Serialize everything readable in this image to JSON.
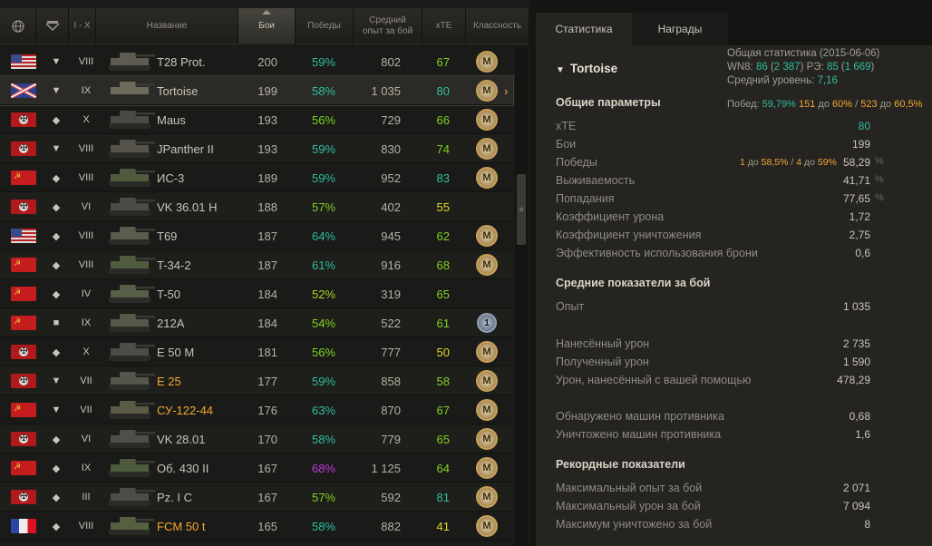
{
  "header": {
    "col_nation": "",
    "col_class": "",
    "col_tier": "I - X",
    "col_name": "Название",
    "col_battles": "Бои",
    "col_wins": "Победы",
    "col_exp": "Средний\nопыт за бой",
    "col_xte": "xTE",
    "col_mastery": "Классность"
  },
  "rows": [
    {
      "nation": "usa",
      "cls": "▼",
      "tier": "VIII",
      "name": "T28 Prot.",
      "prem": false,
      "battles": "200",
      "wins": "59%",
      "wcol": "c-teal",
      "exp": "802",
      "xte": "67",
      "xcol": "c-green",
      "badge": "M"
    },
    {
      "nation": "uk",
      "cls": "▼",
      "tier": "IX",
      "name": "Tortoise",
      "prem": false,
      "battles": "199",
      "wins": "58%",
      "wcol": "c-teal",
      "exp": "1 035",
      "xte": "80",
      "xcol": "c-teal",
      "badge": "M",
      "selected": true
    },
    {
      "nation": "ger",
      "cls": "◆",
      "tier": "X",
      "name": "Maus",
      "prem": false,
      "battles": "193",
      "wins": "56%",
      "wcol": "c-green",
      "exp": "729",
      "xte": "66",
      "xcol": "c-green",
      "badge": "M"
    },
    {
      "nation": "ger",
      "cls": "▼",
      "tier": "VIII",
      "name": "JPanther II",
      "prem": false,
      "battles": "193",
      "wins": "59%",
      "wcol": "c-teal",
      "exp": "830",
      "xte": "74",
      "xcol": "c-green",
      "badge": "M"
    },
    {
      "nation": "ussr",
      "cls": "◆",
      "tier": "VIII",
      "name": "ИС-3",
      "prem": false,
      "battles": "189",
      "wins": "59%",
      "wcol": "c-teal",
      "exp": "952",
      "xte": "83",
      "xcol": "c-teal",
      "badge": "M"
    },
    {
      "nation": "ger",
      "cls": "◆",
      "tier": "VI",
      "name": "VK 36.01 H",
      "prem": false,
      "battles": "188",
      "wins": "57%",
      "wcol": "c-green",
      "exp": "402",
      "xte": "55",
      "xcol": "c-yellow",
      "badge": ""
    },
    {
      "nation": "usa",
      "cls": "◆",
      "tier": "VIII",
      "name": "T69",
      "prem": false,
      "battles": "187",
      "wins": "64%",
      "wcol": "c-teal",
      "exp": "945",
      "xte": "62",
      "xcol": "c-green",
      "badge": "M"
    },
    {
      "nation": "ussr",
      "cls": "◆",
      "tier": "VIII",
      "name": "T-34-2",
      "prem": false,
      "battles": "187",
      "wins": "61%",
      "wcol": "c-teal",
      "exp": "916",
      "xte": "68",
      "xcol": "c-green",
      "badge": "M"
    },
    {
      "nation": "ussr",
      "cls": "◆",
      "tier": "IV",
      "name": "T-50",
      "prem": false,
      "battles": "184",
      "wins": "52%",
      "wcol": "c-lime",
      "exp": "319",
      "xte": "65",
      "xcol": "c-green",
      "badge": ""
    },
    {
      "nation": "ussr",
      "cls": "■",
      "tier": "IX",
      "name": "212A",
      "prem": false,
      "battles": "184",
      "wins": "54%",
      "wcol": "c-green",
      "exp": "522",
      "xte": "61",
      "xcol": "c-green",
      "badge": "1"
    },
    {
      "nation": "ger",
      "cls": "◆",
      "tier": "X",
      "name": "E 50 M",
      "prem": false,
      "battles": "181",
      "wins": "56%",
      "wcol": "c-green",
      "exp": "777",
      "xte": "50",
      "xcol": "c-yellow",
      "badge": "M"
    },
    {
      "nation": "ger",
      "cls": "▼",
      "tier": "VII",
      "name": "E 25",
      "prem": true,
      "battles": "177",
      "wins": "59%",
      "wcol": "c-teal",
      "exp": "858",
      "xte": "58",
      "xcol": "c-green",
      "badge": "M"
    },
    {
      "nation": "ussr",
      "cls": "▼",
      "tier": "VII",
      "name": "СУ-122-44",
      "prem": true,
      "battles": "176",
      "wins": "63%",
      "wcol": "c-teal",
      "exp": "870",
      "xte": "67",
      "xcol": "c-green",
      "badge": "M"
    },
    {
      "nation": "ger",
      "cls": "◆",
      "tier": "VI",
      "name": "VK 28.01",
      "prem": false,
      "battles": "170",
      "wins": "58%",
      "wcol": "c-teal",
      "exp": "779",
      "xte": "65",
      "xcol": "c-green",
      "badge": "M"
    },
    {
      "nation": "ussr",
      "cls": "◆",
      "tier": "IX",
      "name": "Об. 430 II",
      "prem": false,
      "battles": "167",
      "wins": "68%",
      "wcol": "c-purple",
      "exp": "1 125",
      "xte": "64",
      "xcol": "c-green",
      "badge": "M"
    },
    {
      "nation": "ger",
      "cls": "◆",
      "tier": "III",
      "name": "Pz. I C",
      "prem": false,
      "battles": "167",
      "wins": "57%",
      "wcol": "c-green",
      "exp": "592",
      "xte": "81",
      "xcol": "c-teal",
      "badge": "M"
    },
    {
      "nation": "fr",
      "cls": "◆",
      "tier": "VIII",
      "name": "FCM 50 t",
      "prem": true,
      "battles": "165",
      "wins": "58%",
      "wcol": "c-teal",
      "exp": "882",
      "xte": "41",
      "xcol": "c-yellow",
      "badge": "M"
    }
  ],
  "tabs": {
    "stats": "Статистика",
    "awards": "Награды"
  },
  "overview": {
    "line1": "Общая статистика (2015-06-06)",
    "wn8_label": "WN8: ",
    "wn8": "86",
    "wn8_full": "2 387",
    "re_label": " РЭ: ",
    "re": "85",
    "re_full": "1 669",
    "lvl_label": "Средний уровень: ",
    "lvl": "7,16"
  },
  "tank_title": "Tortoise",
  "general": {
    "title": "Общие параметры",
    "win_label": "Побед: ",
    "win": "59,79%",
    "n1": "151",
    "to1": " до ",
    "p1": "60%",
    "sep": " / ",
    "n2": "523",
    "to2": " до ",
    "p2": "60,5%"
  },
  "params": [
    {
      "label": "xTE",
      "value": "80",
      "teal": true
    },
    {
      "label": "Бои",
      "value": "199"
    },
    {
      "label": "Победы",
      "value": "58,29",
      "pct": "%",
      "note_a": "1",
      "note_b": " до ",
      "note_c": "58,5%",
      "note_d": " / ",
      "note_e": "4",
      "note_f": " до ",
      "note_g": "59%"
    },
    {
      "label": "Выживаемость",
      "value": "41,71",
      "pct": "%"
    },
    {
      "label": "Попадания",
      "value": "77,65",
      "pct": "%"
    },
    {
      "label": "Коэффициент урона",
      "value": "1,72"
    },
    {
      "label": "Коэффициент уничтожения",
      "value": "2,75"
    },
    {
      "label": "Эффективность использования брони",
      "value": "0,6"
    }
  ],
  "avg": {
    "title": "Средние показатели за бой",
    "items": [
      {
        "label": "Опыт",
        "value": "1 035"
      },
      {
        "label": "Нанесённый урон",
        "value": "2 735"
      },
      {
        "label": "Полученный урон",
        "value": "1 590"
      },
      {
        "label": "Урон, нанесённый с вашей помощью",
        "value": "478,29"
      },
      {
        "label": "Обнаружено машин противника",
        "value": "0,68"
      },
      {
        "label": "Уничтожено машин противника",
        "value": "1,6"
      }
    ]
  },
  "records": {
    "title": "Рекордные показатели",
    "items": [
      {
        "label": "Максимальный опыт за бой",
        "value": "2 071"
      },
      {
        "label": "Максимальный урон за бой",
        "value": "7 094"
      },
      {
        "label": "Максимум уничтожено за бой",
        "value": "8"
      }
    ]
  }
}
